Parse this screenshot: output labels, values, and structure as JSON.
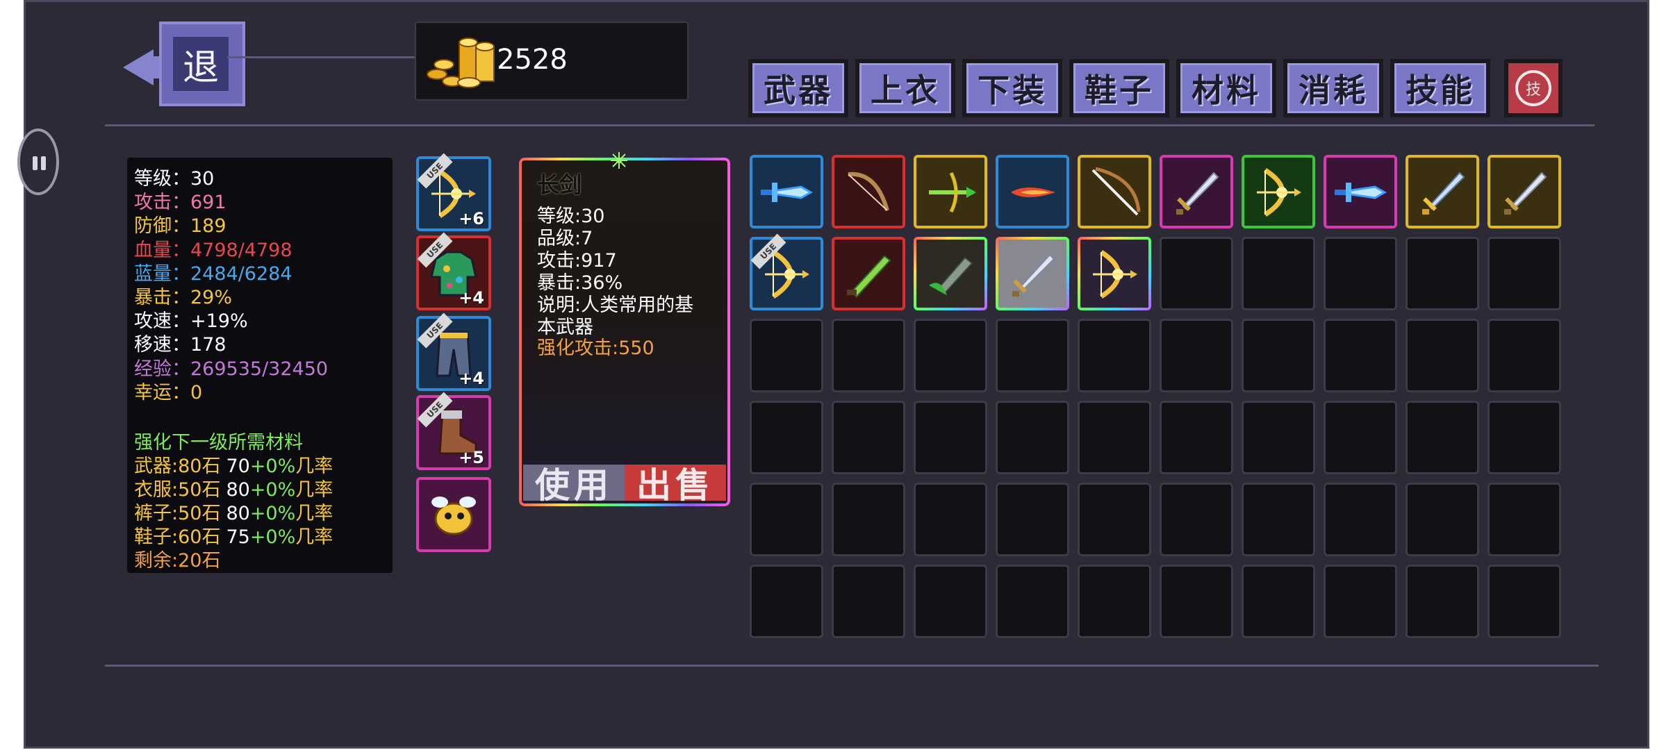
{
  "header": {
    "back_label": "退",
    "gold_amount": "2528"
  },
  "tabs": [
    {
      "label": "武器",
      "name": "tab-weapons"
    },
    {
      "label": "上衣",
      "name": "tab-tops"
    },
    {
      "label": "下装",
      "name": "tab-bottoms"
    },
    {
      "label": "鞋子",
      "name": "tab-shoes"
    },
    {
      "label": "材料",
      "name": "tab-materials"
    },
    {
      "label": "消耗",
      "name": "tab-consumables"
    },
    {
      "label": "技能",
      "name": "tab-skills"
    }
  ],
  "skill_toggle_label": "技",
  "stats": [
    {
      "label": "等级：",
      "value": "30",
      "label_color": "#ffffff",
      "value_color": "#ffffff"
    },
    {
      "label": "攻击：",
      "value": "691",
      "label_color": "#f07aa6",
      "value_color": "#f07aa6"
    },
    {
      "label": "防御：",
      "value": "189",
      "label_color": "#f5c542",
      "value_color": "#f5c542"
    },
    {
      "label": "血量：",
      "value": "4798/4798",
      "label_color": "#e5484d",
      "value_color": "#e5484d"
    },
    {
      "label": "蓝量：",
      "value": "2484/6284",
      "label_color": "#4da6e8",
      "value_color": "#4da6e8"
    },
    {
      "label": "暴击：",
      "value": "29%",
      "label_color": "#f5c542",
      "value_color": "#f5c542"
    },
    {
      "label": "攻速：",
      "value": "+19%",
      "label_color": "#ffffff",
      "value_color": "#ffffff"
    },
    {
      "label": "移速：",
      "value": "178",
      "label_color": "#ffffff",
      "value_color": "#ffffff"
    },
    {
      "label": "经验：",
      "value": "269535/32450",
      "label_color": "#c27ad8",
      "value_color": "#c27ad8"
    },
    {
      "label": "幸运：",
      "value": "0",
      "label_color": "#f5c542",
      "value_color": "#f5c542"
    }
  ],
  "upgrade": {
    "title": "强化下一级所需材料",
    "rows": [
      {
        "item": "武器:80石",
        "base": "70",
        "bonus": "+0%",
        "suffix": "几率"
      },
      {
        "item": "衣服:50石",
        "base": "80",
        "bonus": "+0%",
        "suffix": "几率"
      },
      {
        "item": "裤子:50石",
        "base": "80",
        "bonus": "+0%",
        "suffix": "几率"
      },
      {
        "item": "鞋子:60石",
        "base": "75",
        "bonus": "+0%",
        "suffix": "几率"
      }
    ],
    "remaining": "剩余:20石"
  },
  "equipment": [
    {
      "name": "equipped-weapon",
      "icon": "golden-bow-icon",
      "level": "+6",
      "border": "#2f8ad8",
      "bg": "#17304d",
      "use": "USE"
    },
    {
      "name": "equipped-top",
      "icon": "patterned-jacket-icon",
      "level": "+4",
      "border": "#d83030",
      "bg": "#4a1414",
      "use": "USE"
    },
    {
      "name": "equipped-bottom",
      "icon": "golden-pants-icon",
      "level": "+4",
      "border": "#2f8ad8",
      "bg": "#17304d",
      "use": "USE"
    },
    {
      "name": "equipped-shoes",
      "icon": "leather-boot-icon",
      "level": "+5",
      "border": "#d83ab0",
      "bg": "#4a1440",
      "use": "USE"
    },
    {
      "name": "equipped-pet",
      "icon": "golden-bee-pet-icon",
      "level": "",
      "border": "#d83ab0",
      "bg": "#4a1440",
      "use": ""
    }
  ],
  "detail": {
    "name": "长剑",
    "lines": [
      "等级:30",
      "品级:7",
      "攻击:917",
      "暴击:36%",
      "说明:人类常用的基",
      "本武器"
    ],
    "enhance": "强化攻击:550",
    "use_button": "使用",
    "sell_button": "出售"
  },
  "colors": {
    "panel_bg": "#2b2a36",
    "tab_bg": "#7b77c7",
    "upgrade_title": "#7dea5a",
    "upgrade_item": "#f5c542",
    "upgrade_bonus": "#7dea5a",
    "remaining": "#f5a142",
    "enhance": "#f5a142",
    "sell_bg": "#c63a3a",
    "use_bg": "#6d6a86"
  },
  "inventory": [
    {
      "icon": "frost-blade-icon",
      "border": "#2f8ad8",
      "bg": "#17304d"
    },
    {
      "icon": "wooden-bow-icon",
      "border": "#d83030",
      "bg": "#3a1414"
    },
    {
      "icon": "green-crossbow-icon",
      "border": "#e0b820",
      "bg": "#3a3010"
    },
    {
      "icon": "fire-dagger-icon",
      "border": "#2f8ad8",
      "bg": "#17304d"
    },
    {
      "icon": "white-bow-icon",
      "border": "#e0b820",
      "bg": "#3a3010"
    },
    {
      "icon": "silver-sword-icon",
      "border": "#d83ab0",
      "bg": "#3a1436"
    },
    {
      "icon": "golden-bow-icon",
      "border": "#3ac83a",
      "bg": "#143a14"
    },
    {
      "icon": "frost-blade-icon",
      "border": "#d83ab0",
      "bg": "#3a1436"
    },
    {
      "icon": "golden-sword-icon",
      "border": "#e0b820",
      "bg": "#3a3010"
    },
    {
      "icon": "long-sword-icon",
      "border": "#e0b820",
      "bg": "#3a3010"
    },
    {
      "icon": "golden-bow-icon",
      "border": "#2f8ad8",
      "bg": "#17304d",
      "use": "USE"
    },
    {
      "icon": "green-blade-icon",
      "border": "#d83030",
      "bg": "#3a1414"
    },
    {
      "icon": "jade-blade-icon",
      "border": "#rainbow",
      "bg": "#2c2a22"
    },
    {
      "icon": "steel-sword-icon",
      "border": "#rainbow",
      "bg": "#888890"
    },
    {
      "icon": "golden-bow-icon",
      "border": "#rainbow",
      "bg": "#2c2236"
    }
  ]
}
